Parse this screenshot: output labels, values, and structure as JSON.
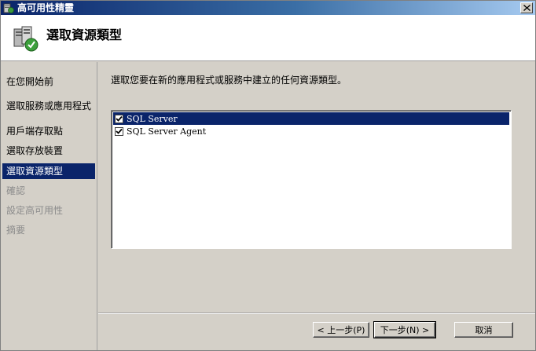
{
  "window": {
    "title": "高可用性精靈",
    "close_icon": "close-icon"
  },
  "header": {
    "title": "選取資源類型",
    "icon": "cluster-server-icon"
  },
  "sidebar": {
    "steps": [
      {
        "label": "在您開始前",
        "state": "done"
      },
      {
        "label": "選取服務或應用程式",
        "state": "done"
      },
      {
        "label": "用戶端存取點",
        "state": "done"
      },
      {
        "label": "選取存放裝置",
        "state": "done"
      },
      {
        "label": "選取資源類型",
        "state": "active"
      },
      {
        "label": "確認",
        "state": "disabled"
      },
      {
        "label": "設定高可用性",
        "state": "disabled"
      },
      {
        "label": "摘要",
        "state": "disabled"
      }
    ]
  },
  "main": {
    "instruction": "選取您要在新的應用程式或服務中建立的任何資源類型。",
    "resource_types": [
      {
        "label": "SQL Server",
        "checked": true,
        "selected": true
      },
      {
        "label": "SQL Server Agent",
        "checked": true,
        "selected": false
      }
    ]
  },
  "buttons": {
    "previous": "< 上一步(P)",
    "next": "下一步(N) >",
    "cancel": "取消"
  },
  "colors": {
    "selection": "#0a246a",
    "face": "#d4d0c8",
    "disabled_text": "#8c8c8c"
  }
}
